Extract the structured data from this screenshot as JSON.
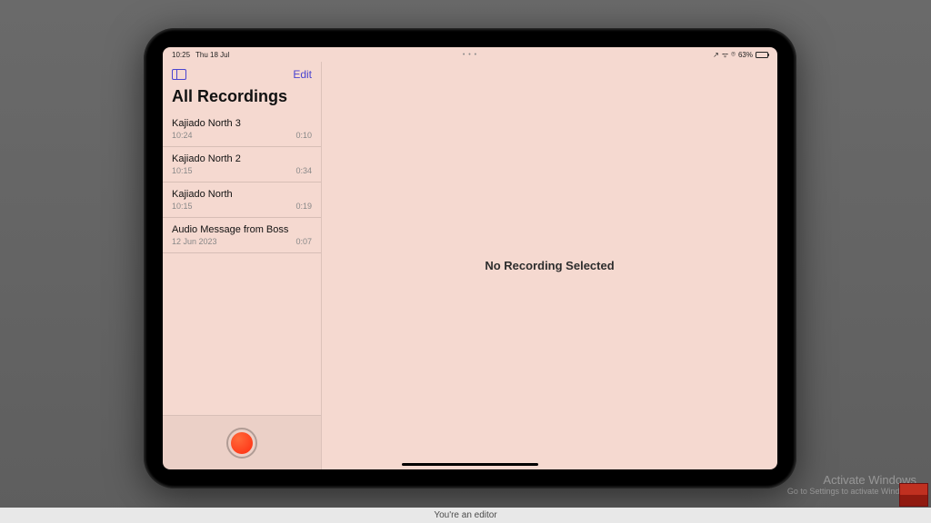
{
  "status": {
    "time": "10:25",
    "date": "Thu 18 Jul",
    "center_dots": "• • •",
    "location_icon": "↗",
    "wifi_icon": "ᯤ",
    "lock_icon": "⌾",
    "battery_pct": "63%"
  },
  "sidebar": {
    "edit_label": "Edit",
    "title": "All Recordings",
    "recordings": [
      {
        "name": "Kajiado North 3",
        "time": "10:24",
        "duration": "0:10"
      },
      {
        "name": "Kajiado North 2",
        "time": "10:15",
        "duration": "0:34"
      },
      {
        "name": "Kajiado North",
        "time": "10:15",
        "duration": "0:19"
      },
      {
        "name": "Audio Message from Boss",
        "time": "12 Jun 2023",
        "duration": "0:07"
      }
    ]
  },
  "detail": {
    "empty_message": "No Recording Selected"
  },
  "watermark": {
    "title": "Activate Windows",
    "sub": "Go to Settings to activate Windows."
  },
  "bottom_bar": {
    "text": "You're an editor"
  }
}
